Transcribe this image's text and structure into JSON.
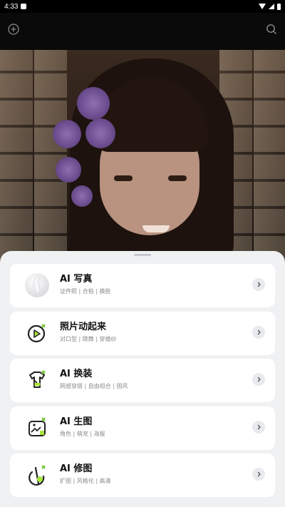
{
  "status_bar": {
    "time": "4:33"
  },
  "top_bar": {
    "left_icon": "plus-circle-icon",
    "right_icon": "search-icon"
  },
  "hero": {
    "description_icon": "portrait-photo"
  },
  "features": [
    {
      "title": "AI 写真",
      "subtitle": "证件照 | 合拍 | 换脸",
      "icon": "ai-portrait-icon"
    },
    {
      "title": "照片动起来",
      "subtitle": "对口型 | 跳舞 | 穿婚纱",
      "icon": "play-video-icon"
    },
    {
      "title": "AI 换装",
      "subtitle": "网感穿搭 | 自由组合 | 国风",
      "icon": "tshirt-icon"
    },
    {
      "title": "AI 生图",
      "subtitle": "角色 | 萌宠 | 海报",
      "icon": "image-generate-icon"
    },
    {
      "title": "AI 修图",
      "subtitle": "扩图 | 风格化 | 高清",
      "icon": "retouch-icon"
    }
  ],
  "colors": {
    "accent": "#a8e63a",
    "sheet_bg": "#f0f1f3",
    "card_bg": "#ffffff"
  }
}
